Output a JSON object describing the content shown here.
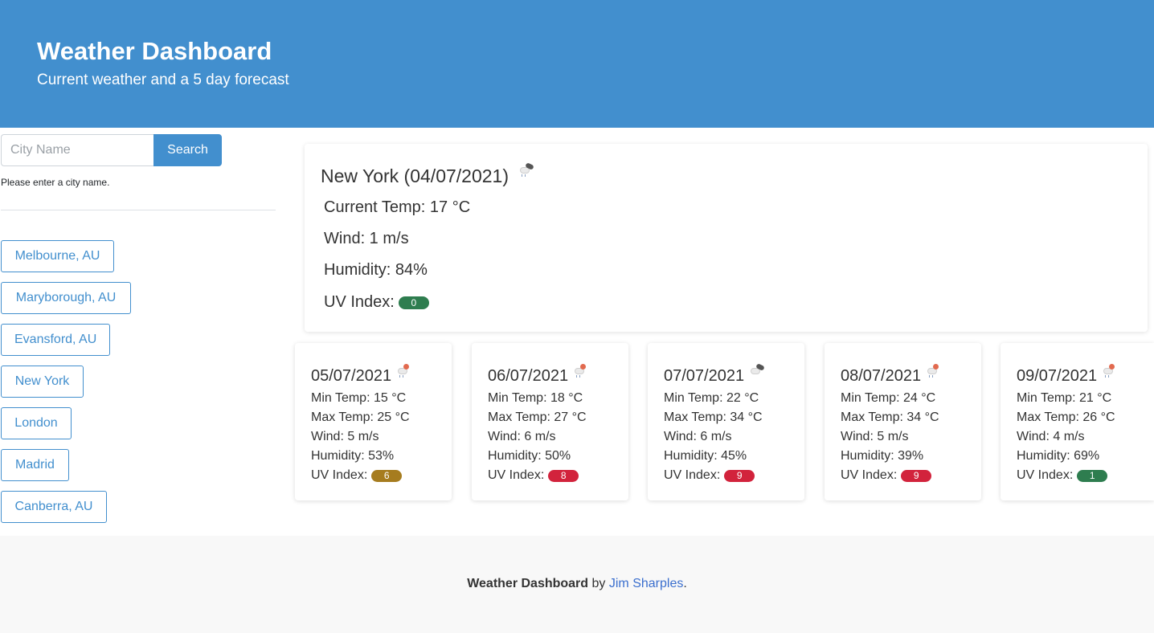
{
  "header": {
    "title": "Weather Dashboard",
    "subtitle": "Current weather and a 5 day forecast"
  },
  "search": {
    "placeholder": "City Name",
    "value": "",
    "button_label": "Search",
    "help_text": "Please enter a city name."
  },
  "history": {
    "cities": [
      {
        "label": "Melbourne, AU"
      },
      {
        "label": "Maryborough, AU"
      },
      {
        "label": "Evansford, AU"
      },
      {
        "label": "New York"
      },
      {
        "label": "London"
      },
      {
        "label": "Madrid"
      },
      {
        "label": "Canberra, AU"
      }
    ]
  },
  "current": {
    "title": "New York (04/07/2021)",
    "icon": "cloud-rain-icon",
    "temp": "Current Temp: 17 °C",
    "wind": "Wind: 1 m/s",
    "humidity": "Humidity: 84%",
    "uv_label": "UV Index:",
    "uv_value": "0",
    "uv_color": "#2e7d4f"
  },
  "forecast": [
    {
      "date": "05/07/2021",
      "icon": "sun-cloud-rain-icon",
      "min": "Min Temp: 15 °C",
      "max": "Max Temp: 25 °C",
      "wind": "Wind: 5 m/s",
      "humidity": "Humidity: 53%",
      "uv_label": "UV Index:",
      "uv": "6",
      "uv_color": "#a67c1f"
    },
    {
      "date": "06/07/2021",
      "icon": "sun-cloud-rain-icon",
      "min": "Min Temp: 18 °C",
      "max": "Max Temp: 27 °C",
      "wind": "Wind: 6 m/s",
      "humidity": "Humidity: 50%",
      "uv_label": "UV Index:",
      "uv": "8",
      "uv_color": "#d2233c"
    },
    {
      "date": "07/07/2021",
      "icon": "broken-clouds-icon",
      "min": "Min Temp: 22 °C",
      "max": "Max Temp: 34 °C",
      "wind": "Wind: 6 m/s",
      "humidity": "Humidity: 45%",
      "uv_label": "UV Index:",
      "uv": "9",
      "uv_color": "#d2233c"
    },
    {
      "date": "08/07/2021",
      "icon": "sun-cloud-rain-icon",
      "min": "Min Temp: 24 °C",
      "max": "Max Temp: 34 °C",
      "wind": "Wind: 5 m/s",
      "humidity": "Humidity: 39%",
      "uv_label": "UV Index:",
      "uv": "9",
      "uv_color": "#d2233c"
    },
    {
      "date": "09/07/2021",
      "icon": "sun-cloud-rain-icon",
      "min": "Min Temp: 21 °C",
      "max": "Max Temp: 26 °C",
      "wind": "Wind: 4 m/s",
      "humidity": "Humidity: 69%",
      "uv_label": "UV Index:",
      "uv": "1",
      "uv_color": "#2e7d4f"
    }
  ],
  "footer": {
    "app_name": "Weather Dashboard",
    "by": " by ",
    "author": "Jim Sharples",
    "end": "."
  },
  "colors": {
    "primary": "#428fce",
    "uv_low": "#2e7d4f",
    "uv_moderate": "#a67c1f",
    "uv_high": "#d2233c"
  }
}
